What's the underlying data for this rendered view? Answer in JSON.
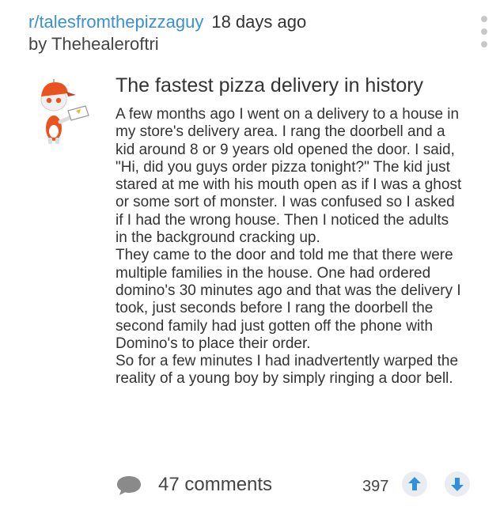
{
  "post": {
    "subreddit": "r/talesfromthepizzaguy",
    "age": "18 days ago",
    "author": "by Thehealeroftri",
    "title": "The fastest pizza delivery in history",
    "paragraphs": [
      "A few months ago I went on a delivery to a house in my store's delivery area. I rang the doorbell and a kid around 8 or 9 years old opened the door. I said, \"Hi, did you guys order pizza tonight?\" The kid just stared at me with his mouth open as if I was a ghost or some sort of monster. I was confused so I asked if I had the wrong house. Then I noticed the adults in the background cracking up.",
      "They came to the door and told me that there were multiple families in the house. One had ordered domino's 30 minutes ago and that was the delivery I took, just seconds before I rang the doorbell the second family had just gotten off the phone with Domino's to place their order.",
      "So for a few minutes I had inadvertently warped the reality of a young boy by simply ringing a door bell."
    ]
  },
  "footer": {
    "comments_label": "47 comments",
    "score": "397"
  },
  "icons": {
    "more": "more-options-icon",
    "thumbnail": "pizza-mascot-icon",
    "comments": "comment-bubble-icon",
    "upvote": "upvote-arrow-icon",
    "downvote": "downvote-arrow-icon"
  },
  "colors": {
    "link": "#3a8fd6",
    "vote_arrow": "#2f8fe0",
    "icon_gray": "#8a8a8a",
    "mascot_orange": "#e8531f"
  }
}
